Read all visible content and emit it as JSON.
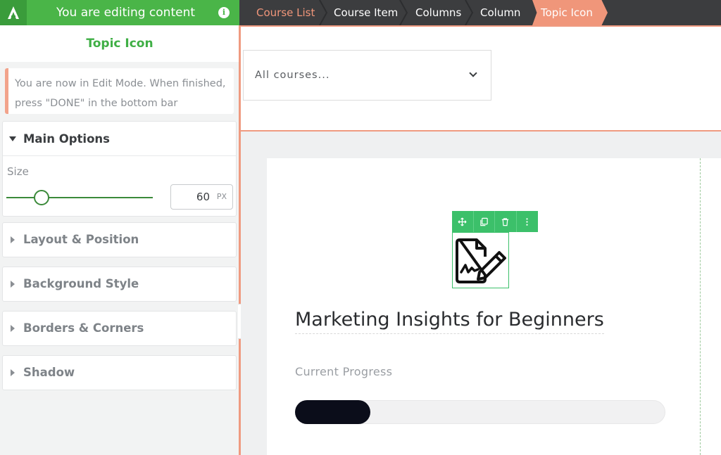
{
  "sidebar": {
    "header_title": "You are editing content",
    "panel_title": "Topic Icon",
    "notice": "You are now in Edit Mode. When finished, press \"DONE\" in the bottom bar",
    "main_options": {
      "label": "Main Options",
      "size_label": "Size",
      "size_value": "60",
      "size_unit": "PX",
      "slider_fraction": 0.24
    },
    "panels": [
      "Layout & Position",
      "Background Style",
      "Borders & Corners",
      "Shadow"
    ]
  },
  "breadcrumbs": [
    "Course List",
    "Course Item",
    "Columns",
    "Column",
    "Topic Icon"
  ],
  "canvas": {
    "course_select": "All courses...",
    "course_title": "Marketing Insights for Beginners",
    "progress_label": "Current Progress",
    "progress_fraction": 0.2
  },
  "colors": {
    "brand_green": "#4ab548",
    "accent_orange": "#f0967a",
    "toolbar_green": "#3cc06a",
    "progress_fill": "#0b0d1a"
  },
  "icons": {
    "logo": "a-logo-icon",
    "info": "info-icon",
    "topic": "document-signature-icon",
    "toolbar": [
      "move-icon",
      "duplicate-icon",
      "trash-icon",
      "more-vertical-icon"
    ]
  }
}
